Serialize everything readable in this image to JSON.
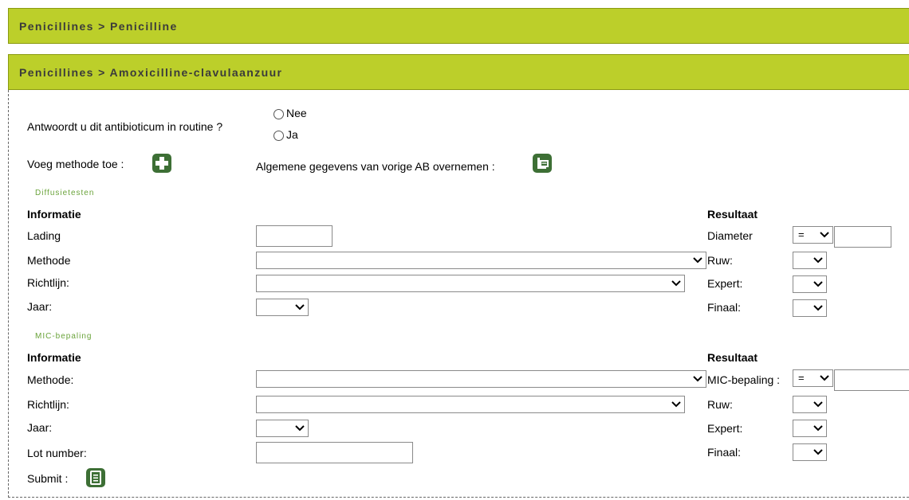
{
  "breadcrumbs": [
    "Penicillines > Penicilline",
    "Penicillines > Amoxicilline-clavulaanzuur"
  ],
  "routine": {
    "question": "Antwoordt u dit antibioticum in routine ?",
    "options": [
      "Nee",
      "Ja"
    ]
  },
  "actions": {
    "add_method_label": "Voeg methode toe :",
    "copy_label": "Algemene gegevens van vorige AB overnemen :",
    "submit_label": "Submit :"
  },
  "diffusion": {
    "section_title": "Diffusietesten",
    "info_header": "Informatie",
    "result_header": "Resultaat",
    "fields": {
      "lading": "Lading",
      "methode": "Methode",
      "richtlijn": "Richtlijn:",
      "jaar": "Jaar:"
    },
    "results": {
      "diameter": "Diameter",
      "operator": "=",
      "ruw": "Ruw:",
      "expert": "Expert:",
      "finaal": "Finaal:"
    }
  },
  "mic": {
    "section_title": "MIC-bepaling",
    "info_header": "Informatie",
    "result_header": "Resultaat",
    "fields": {
      "methode": "Methode:",
      "richtlijn": "Richtlijn:",
      "jaar": "Jaar:",
      "lot": "Lot number:"
    },
    "results": {
      "mic": "MIC-bepaling :",
      "operator": "=",
      "ruw": "Ruw:",
      "expert": "Expert:",
      "finaal": "Finaal:"
    }
  },
  "colors": {
    "header_bar": "#bccf2a",
    "button_green": "#3d6f35",
    "section_green": "#6aa33a"
  }
}
